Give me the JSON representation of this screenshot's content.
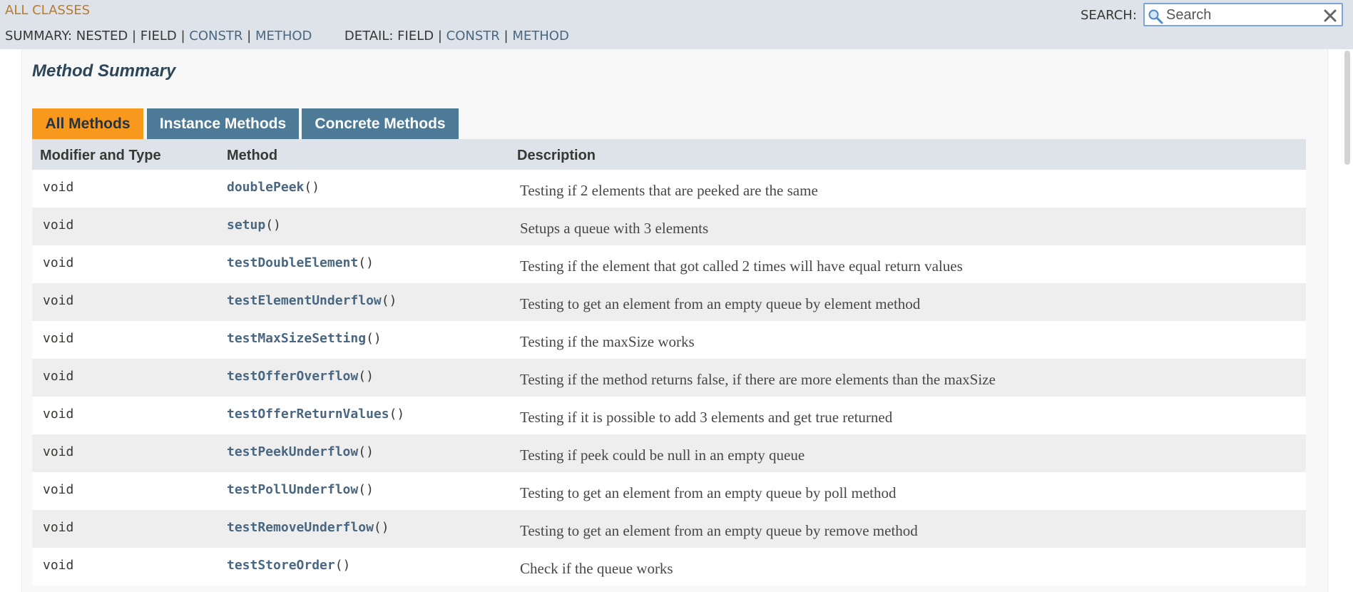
{
  "nav": {
    "all_classes": "ALL CLASSES",
    "summary_label": "SUMMARY:",
    "summary_nested": "NESTED",
    "summary_field": "FIELD",
    "summary_constr": "CONSTR",
    "summary_method": "METHOD",
    "detail_label": "DETAIL:",
    "detail_field": "FIELD",
    "detail_constr": "CONSTR",
    "detail_method": "METHOD",
    "separator": "|"
  },
  "search": {
    "label": "SEARCH:",
    "placeholder": "Search"
  },
  "section_title": "Method Summary",
  "tabs": [
    {
      "label": "All Methods",
      "active": true
    },
    {
      "label": "Instance Methods",
      "active": false
    },
    {
      "label": "Concrete Methods",
      "active": false
    }
  ],
  "table": {
    "headers": {
      "modifier": "Modifier and Type",
      "method": "Method",
      "description": "Description"
    },
    "rows": [
      {
        "type": "void",
        "method": "doublePeek",
        "params": "()",
        "description": "Testing if 2 elements that are peeked are the same"
      },
      {
        "type": "void",
        "method": "setup",
        "params": "()",
        "description": "Setups a queue with 3 elements"
      },
      {
        "type": "void",
        "method": "testDoubleElement",
        "params": "()",
        "description": "Testing if the element that got called 2 times will have equal return values"
      },
      {
        "type": "void",
        "method": "testElementUnderflow",
        "params": "()",
        "description": "Testing to get an element from an empty queue by element method"
      },
      {
        "type": "void",
        "method": "testMaxSizeSetting",
        "params": "()",
        "description": "Testing if the maxSize works"
      },
      {
        "type": "void",
        "method": "testOfferOverflow",
        "params": "()",
        "description": "Testing if the method returns false, if there are more elements than the maxSize"
      },
      {
        "type": "void",
        "method": "testOfferReturnValues",
        "params": "()",
        "description": "Testing if it is possible to add 3 elements and get true returned"
      },
      {
        "type": "void",
        "method": "testPeekUnderflow",
        "params": "()",
        "description": "Testing if peek could be null in an empty queue"
      },
      {
        "type": "void",
        "method": "testPollUnderflow",
        "params": "()",
        "description": "Testing to get an element from an empty queue by poll method"
      },
      {
        "type": "void",
        "method": "testRemoveUnderflow",
        "params": "()",
        "description": "Testing to get an element from an empty queue by remove method"
      },
      {
        "type": "void",
        "method": "testStoreOrder",
        "params": "()",
        "description": "Check if the queue works"
      }
    ]
  },
  "colors": {
    "nav_bg": "#dee3e9",
    "link": "#4a6782",
    "tab_active": "#f8981d",
    "tab_inactive": "#4d7a97",
    "all_classes": "#bb7a2a"
  }
}
